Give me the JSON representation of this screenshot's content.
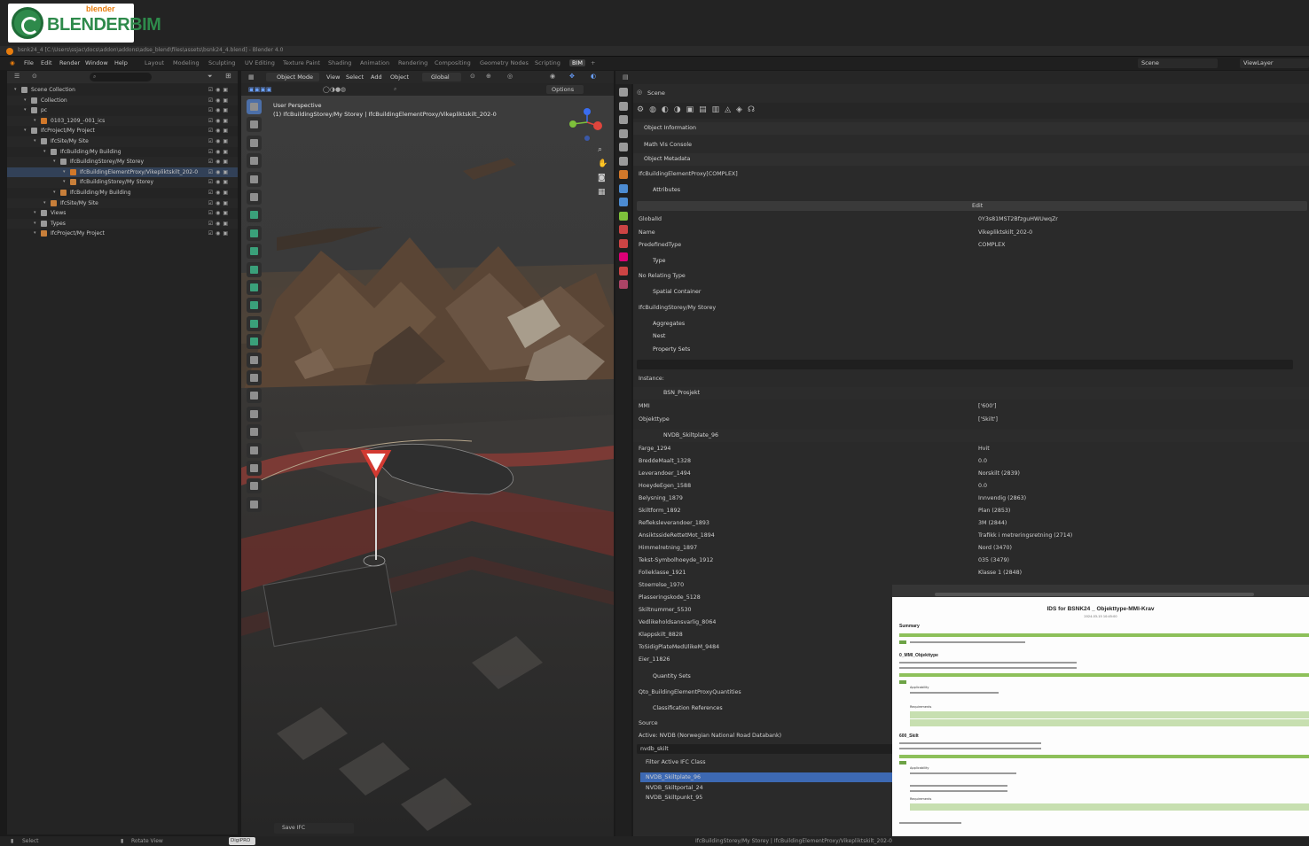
{
  "logo": {
    "brand": "BLENDERBIM",
    "badge": "blender"
  },
  "window": {
    "title": "bsnk24_4 [C:\\Users\\ssjac\\docs\\addon\\addons\\adse_blend\\files\\assets\\bsnk24_4.blend] - Blender 4.0"
  },
  "menubar": {
    "menus": [
      "File",
      "Edit",
      "Render",
      "Window",
      "Help"
    ],
    "workspaces": [
      "Layout",
      "Modeling",
      "Sculpting",
      "UV Editing",
      "Texture Paint",
      "Shading",
      "Animation",
      "Rendering",
      "Compositing",
      "Geometry Nodes",
      "Scripting",
      "BIM"
    ],
    "active_workspace": "BIM",
    "scene": "Scene",
    "view_layer": "ViewLayer"
  },
  "outliner": {
    "rows": [
      {
        "label": "Scene Collection",
        "indent": 0,
        "icon": "collection"
      },
      {
        "label": "Collection",
        "indent": 1,
        "icon": "collection"
      },
      {
        "label": "pc",
        "indent": 1,
        "icon": "collection"
      },
      {
        "label": "0103_1209_-001_ics",
        "indent": 2,
        "icon": "pointcloud"
      },
      {
        "label": "IfcProject/My Project",
        "indent": 1,
        "icon": "collection"
      },
      {
        "label": "IfcSite/My Site",
        "indent": 2,
        "icon": "collection"
      },
      {
        "label": "IfcBuilding/My Building",
        "indent": 3,
        "icon": "collection"
      },
      {
        "label": "IfcBuildingStorey/My Storey",
        "indent": 4,
        "icon": "collection"
      },
      {
        "label": "IfcBuildingElementProxy/Vikepliktskilt_202-0",
        "indent": 5,
        "icon": "object",
        "selected": true
      },
      {
        "label": "IfcBuildingStorey/My Storey",
        "indent": 5,
        "icon": "empty"
      },
      {
        "label": "IfcBuilding/My Building",
        "indent": 4,
        "icon": "empty"
      },
      {
        "label": "IfcSite/My Site",
        "indent": 3,
        "icon": "empty"
      },
      {
        "label": "Views",
        "indent": 2,
        "icon": "collection"
      },
      {
        "label": "Types",
        "indent": 2,
        "icon": "collection"
      },
      {
        "label": "IfcProject/My Project",
        "indent": 2,
        "icon": "empty"
      }
    ]
  },
  "viewport": {
    "header": {
      "mode": "Object Mode",
      "menus": [
        "View",
        "Select",
        "Add",
        "Object"
      ],
      "transform": "Global",
      "options": "Options"
    },
    "overlay_title": "User Perspective",
    "overlay_sub": "(1) IfcBuildingStorey/My Storey | IfcBuildingElementProxy/Vikepliktskilt_202-0",
    "save_button": "Save IFC"
  },
  "properties": {
    "scene_label": "Scene",
    "panels": {
      "object_information": "Object Information",
      "math_vis": "Math Vis Console",
      "object_metadata": "Object Metadata",
      "entity": "IfcBuildingElementProxy[COMPLEX]",
      "attributes": "Attributes",
      "edit": "Edit",
      "type": "Type",
      "no_type": "No Relating Type",
      "spatial": "Spatial Container",
      "spatial_value": "IfcBuildingStorey/My Storey",
      "aggregates": "Aggregates",
      "nest": "Nest",
      "property_sets": "Property Sets",
      "instance": "Instance:",
      "quantity_sets": "Quantity Sets",
      "qto": "Qto_BuildingElementProxyQuantities",
      "classification": "Classification References",
      "source": "Source",
      "active_source": "Active: NVDB (Norwegian National Road Databank)",
      "source_field": "nvdb_skilt",
      "filter": "Filter Active IFC Class"
    },
    "attributes": [
      {
        "k": "GlobalId",
        "v": "0Y3s81MST2BfzguHWUwqZr"
      },
      {
        "k": "Name",
        "v": "Vikepliktskilt_202-0"
      },
      {
        "k": "PredefinedType",
        "v": "COMPLEX"
      }
    ],
    "pset1": {
      "name": "BSN_Prosjekt",
      "rows": [
        {
          "k": "MMI",
          "v": "['600']"
        },
        {
          "k": "Objekttype",
          "v": "['Skilt']"
        }
      ]
    },
    "pset2": {
      "name": "NVDB_Skiltplate_96",
      "rows": [
        {
          "k": "Farge_1294",
          "v": "Hvit"
        },
        {
          "k": "BreddeMaalt_1328",
          "v": "0.0"
        },
        {
          "k": "Leverandoer_1494",
          "v": "Norskilt (2839)"
        },
        {
          "k": "HoeydeEgen_1588",
          "v": "0.0"
        },
        {
          "k": "Belysning_1879",
          "v": "Innvendig (2863)"
        },
        {
          "k": "Skiltform_1892",
          "v": "Plan (2853)"
        },
        {
          "k": "Refleksleverandoer_1893",
          "v": "3M (2844)"
        },
        {
          "k": "AnsiktssideRettetMot_1894",
          "v": "Trafikk i metreringsretning (2714)"
        },
        {
          "k": "Himmelretning_1897",
          "v": "Nord (3470)"
        },
        {
          "k": "Tekst-Symbolhoeyde_1912",
          "v": "035 (3479)"
        },
        {
          "k": "Folieklasse_1921",
          "v": "Klasse 1 (2848)"
        },
        {
          "k": "Stoerrelse_1970",
          "v": ""
        },
        {
          "k": "Plasseringskode_5128",
          "v": ""
        },
        {
          "k": "Skiltnummer_5530",
          "v": ""
        },
        {
          "k": "Vedlikeholdsansvarlig_8064",
          "v": ""
        },
        {
          "k": "Klappskilt_8828",
          "v": ""
        },
        {
          "k": "ToSidigPlateMedUlikeM_9484",
          "v": ""
        },
        {
          "k": "Eier_11826",
          "v": ""
        }
      ]
    },
    "class_list": [
      "NVDB_Skiltplate_96",
      "NVDB_Skiltportal_24",
      "NVDB_Skiltpunkt_95"
    ]
  },
  "ids_report": {
    "title": "IDS for BSNK24 _ Objekttype-MMI-Krav",
    "subtitle": "2024-03-15 10:45:00",
    "summary": "Summary",
    "spec1": "0_MMI_Objekttype",
    "spec2": "600_Skilt",
    "applicability": "Applicability",
    "requirements": "Requirements"
  },
  "statusbar": {
    "select": "Select",
    "rotate": "Rotate View",
    "badge": "DigiPRO",
    "context": "IfcBuildingStorey/My Storey | IfcBuildingElementProxy/Vikepliktskilt_202-0"
  }
}
